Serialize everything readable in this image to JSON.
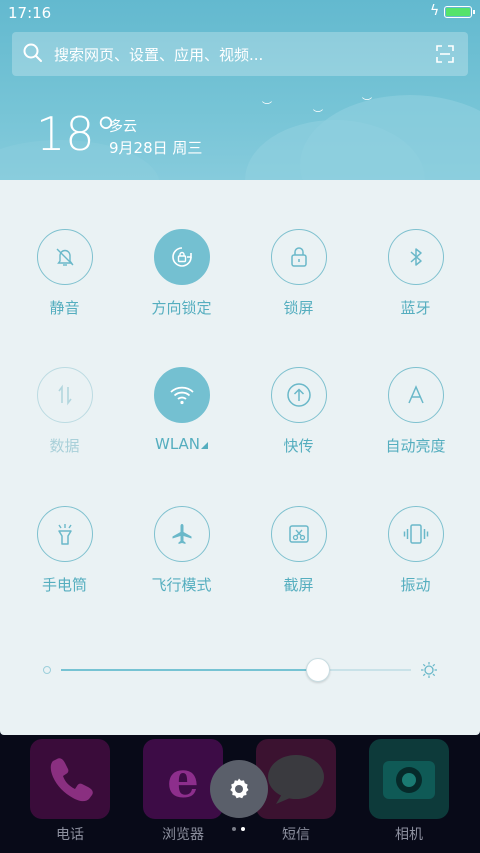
{
  "status_bar": {
    "time": "17:16",
    "battery_level": 1.0,
    "charging": true
  },
  "search": {
    "placeholder": "搜索网页、设置、应用、视频..."
  },
  "weather": {
    "temperature": "18°",
    "condition": "多云",
    "date": "9月28日 周三"
  },
  "toggles": [
    {
      "label": "静音",
      "icon": "bell-off-icon",
      "state": "off"
    },
    {
      "label": "方向锁定",
      "icon": "rotation-lock-icon",
      "state": "on"
    },
    {
      "label": "锁屏",
      "icon": "lock-icon",
      "state": "off"
    },
    {
      "label": "蓝牙",
      "icon": "bluetooth-icon",
      "state": "off"
    },
    {
      "label": "数据",
      "icon": "mobile-data-icon",
      "state": "disabled"
    },
    {
      "label": "WLAN",
      "icon": "wifi-icon",
      "state": "on"
    },
    {
      "label": "快传",
      "icon": "upload-icon",
      "state": "off"
    },
    {
      "label": "自动亮度",
      "icon": "auto-brightness-icon",
      "state": "off"
    },
    {
      "label": "手电筒",
      "icon": "flashlight-icon",
      "state": "off"
    },
    {
      "label": "飞行模式",
      "icon": "airplane-icon",
      "state": "off"
    },
    {
      "label": "截屏",
      "icon": "screenshot-icon",
      "state": "off"
    },
    {
      "label": "振动",
      "icon": "vibrate-icon",
      "state": "off"
    }
  ],
  "brightness": {
    "value": 0.73
  },
  "dock": {
    "apps": [
      {
        "label": "电话",
        "icon": "phone-icon"
      },
      {
        "label": "浏览器",
        "icon": "browser-icon"
      },
      {
        "label": "短信",
        "icon": "sms-icon"
      },
      {
        "label": "相机",
        "icon": "camera-icon"
      }
    ],
    "settings_button": {
      "icon": "gear-icon"
    },
    "page_count": 2,
    "current_page": 2
  },
  "colors": {
    "accent": "#74c0d1",
    "panel_bg": "#eaf2f4",
    "header_bg": "#6bbdd2",
    "dock_bg": "#080a18"
  }
}
